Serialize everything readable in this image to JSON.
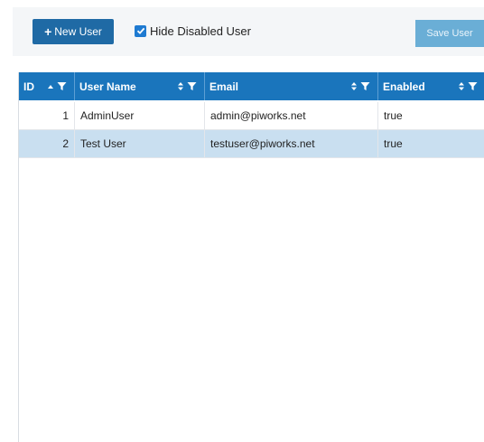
{
  "toolbar": {
    "new_user_label": "New User",
    "hide_disabled_label": "Hide Disabled User",
    "hide_disabled_checked": true,
    "save_user_label": "Save User"
  },
  "grid": {
    "columns": [
      {
        "key": "id",
        "label": "ID"
      },
      {
        "key": "user_name",
        "label": "User Name"
      },
      {
        "key": "email",
        "label": "Email"
      },
      {
        "key": "enabled",
        "label": "Enabled"
      }
    ],
    "rows": [
      {
        "id": "1",
        "user_name": "AdminUser",
        "email": "admin@piworks.net",
        "enabled": "true",
        "selected": false
      },
      {
        "id": "2",
        "user_name": "Test User",
        "email": "testuser@piworks.net",
        "enabled": "true",
        "selected": true
      }
    ]
  },
  "colors": {
    "primary": "#1f6aa5",
    "header": "#1a75bc",
    "save_button": "#6aaed6",
    "selected_row": "#c9dff0",
    "checkbox": "#1e7ad1"
  },
  "icons": [
    "plus-icon",
    "checkbox-checked-icon",
    "sort-asc-icon",
    "sort-icon",
    "filter-icon"
  ]
}
